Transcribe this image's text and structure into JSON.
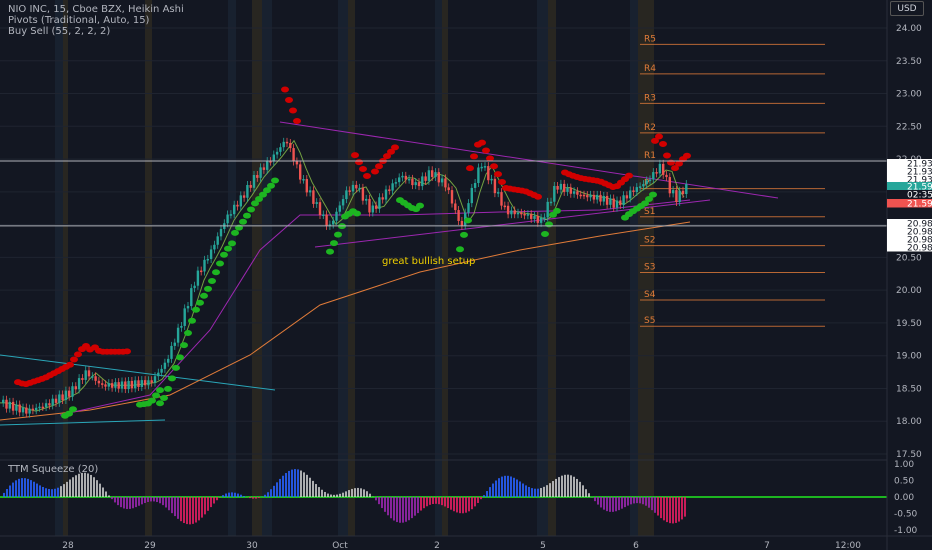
{
  "header": {
    "symbol_line": "NIO INC, 15, Cboe BZX, Heikin Ashi",
    "pivots_line": "Pivots (Traditional, Auto, 15)",
    "buysell_line": "Buy Sell  (55, 2, 2, 2)",
    "currency": "USD"
  },
  "annotation": {
    "text": "great bullish setup",
    "color": "#f0d000"
  },
  "colors": {
    "background": "#131722",
    "up": "#26a69a",
    "down": "#ef5350",
    "buy_marker": "#1db521",
    "sell_marker": "#d10000",
    "pivot": "#e07b39"
  },
  "chart_data": {
    "type": "candlestick",
    "price_axis": {
      "ylim": [
        17.5,
        24.0
      ],
      "ticks": [
        "24.00",
        "23.50",
        "23.00",
        "22.50",
        "22.00",
        "21.50",
        "21.00",
        "20.50",
        "20.00",
        "19.50",
        "19.00",
        "18.50",
        "18.00",
        "17.50"
      ]
    },
    "time_axis": {
      "labels": [
        "28",
        "29",
        "30",
        "Oct",
        "2",
        "5",
        "6",
        "7",
        "12:00"
      ]
    },
    "pivots": [
      {
        "name": "R5",
        "value": 23.75
      },
      {
        "name": "R4",
        "value": 23.3
      },
      {
        "name": "R3",
        "value": 22.85
      },
      {
        "name": "R2",
        "value": 22.4
      },
      {
        "name": "R1",
        "value": 21.97
      },
      {
        "name": "P",
        "value": 21.55
      },
      {
        "name": "S1",
        "value": 21.12
      },
      {
        "name": "S2",
        "value": 20.68
      },
      {
        "name": "S3",
        "value": 20.27
      },
      {
        "name": "S4",
        "value": 19.85
      },
      {
        "name": "S5",
        "value": 19.45
      }
    ],
    "price_labels": [
      {
        "text": "21.93",
        "type": "plain"
      },
      {
        "text": "21.93",
        "type": "plain"
      },
      {
        "text": "21.93",
        "type": "plain"
      },
      {
        "text": "21.59",
        "type": "green"
      },
      {
        "text": "02:35",
        "type": "dark"
      },
      {
        "text": "21.59",
        "type": "red"
      },
      {
        "text": "20.98",
        "type": "plain"
      },
      {
        "text": "20.98",
        "type": "plain"
      },
      {
        "text": "20.98",
        "type": "plain"
      },
      {
        "text": "20.98",
        "type": "plain"
      }
    ],
    "horizontal_lines": [
      21.97,
      20.98
    ],
    "price_path": [
      [
        0,
        18.28
      ],
      [
        25,
        18.15
      ],
      [
        45,
        18.25
      ],
      [
        70,
        18.45
      ],
      [
        85,
        18.75
      ],
      [
        100,
        18.55
      ],
      [
        125,
        18.55
      ],
      [
        150,
        18.6
      ],
      [
        165,
        18.9
      ],
      [
        180,
        19.5
      ],
      [
        195,
        20.2
      ],
      [
        210,
        20.6
      ],
      [
        225,
        21.1
      ],
      [
        240,
        21.4
      ],
      [
        255,
        21.75
      ],
      [
        270,
        22.0
      ],
      [
        285,
        22.3
      ],
      [
        300,
        21.7
      ],
      [
        315,
        21.3
      ],
      [
        328,
        20.95
      ],
      [
        345,
        21.5
      ],
      [
        355,
        21.6
      ],
      [
        370,
        21.2
      ],
      [
        385,
        21.5
      ],
      [
        400,
        21.75
      ],
      [
        415,
        21.6
      ],
      [
        430,
        21.8
      ],
      [
        445,
        21.6
      ],
      [
        460,
        20.95
      ],
      [
        470,
        21.5
      ],
      [
        480,
        21.95
      ],
      [
        495,
        21.5
      ],
      [
        505,
        21.2
      ],
      [
        525,
        21.15
      ],
      [
        540,
        21.05
      ],
      [
        555,
        21.6
      ],
      [
        570,
        21.5
      ],
      [
        580,
        21.45
      ],
      [
        600,
        21.4
      ],
      [
        615,
        21.3
      ],
      [
        630,
        21.5
      ],
      [
        645,
        21.65
      ],
      [
        660,
        21.9
      ],
      [
        668,
        21.55
      ],
      [
        675,
        21.4
      ],
      [
        686,
        21.59
      ]
    ],
    "squeeze": {
      "title": "TTM Squeeze (20)",
      "ticks": [
        "1.00",
        "0.50",
        "0.00",
        "-0.50",
        "-1.00"
      ],
      "ylim": [
        -1.0,
        1.0
      ]
    }
  }
}
